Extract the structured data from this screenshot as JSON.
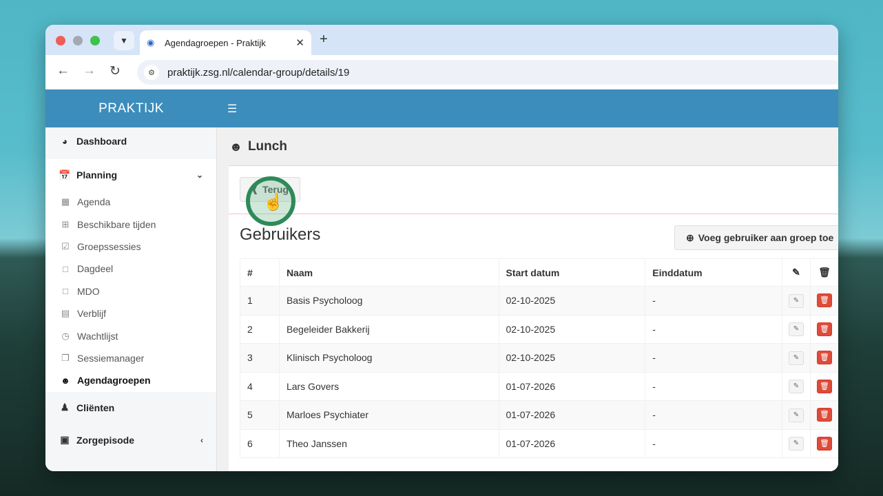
{
  "browser": {
    "tab_title": "Agendagroepen - Praktijk",
    "url": "praktijk.zsg.nl/calendar-group/details/19"
  },
  "app": {
    "brand": "PRAKTIJK"
  },
  "sidebar": {
    "items": [
      {
        "label": "Dashboard",
        "icon": "dashboard-icon"
      },
      {
        "label": "Planning",
        "icon": "calendar-icon"
      },
      {
        "label": "Cliënten",
        "icon": "user-icon"
      },
      {
        "label": "Zorgepisode",
        "icon": "medkit-icon"
      }
    ],
    "planning_sub": [
      {
        "label": "Agenda",
        "icon": "calendar-icon"
      },
      {
        "label": "Beschikbare tijden",
        "icon": "calendar-plus-icon"
      },
      {
        "label": "Groepssessies",
        "icon": "calendar-check-icon"
      },
      {
        "label": "Dagdeel",
        "icon": "calendar-icon"
      },
      {
        "label": "MDO",
        "icon": "calendar-icon"
      },
      {
        "label": "Verblijf",
        "icon": "bed-icon"
      },
      {
        "label": "Wachtlijst",
        "icon": "clock-icon"
      },
      {
        "label": "Sessiemanager",
        "icon": "copy-icon"
      },
      {
        "label": "Agendagroepen",
        "icon": "users-icon"
      }
    ]
  },
  "page": {
    "title": "Lunch",
    "back_label": "Terug",
    "section_title": "Gebruikers",
    "add_label": "Voeg gebruiker aan groep toe"
  },
  "table": {
    "headers": [
      "#",
      "Naam",
      "Start datum",
      "Einddatum"
    ],
    "rows": [
      {
        "num": "1",
        "naam": "Basis Psycholoog",
        "start": "02-10-2025",
        "eind": "-"
      },
      {
        "num": "2",
        "naam": "Begeleider Bakkerij",
        "start": "02-10-2025",
        "eind": "-"
      },
      {
        "num": "3",
        "naam": "Klinisch Psycholoog",
        "start": "02-10-2025",
        "eind": "-"
      },
      {
        "num": "4",
        "naam": "Lars Govers",
        "start": "01-07-2026",
        "eind": "-"
      },
      {
        "num": "5",
        "naam": "Marloes Psychiater",
        "start": "01-07-2026",
        "eind": "-"
      },
      {
        "num": "6",
        "naam": "Theo Janssen",
        "start": "01-07-2026",
        "eind": "-"
      }
    ]
  },
  "colors": {
    "header_blue": "#3c8dbc",
    "delete_red": "#dd4b39",
    "cursor_ring": "#2e8a5a"
  }
}
